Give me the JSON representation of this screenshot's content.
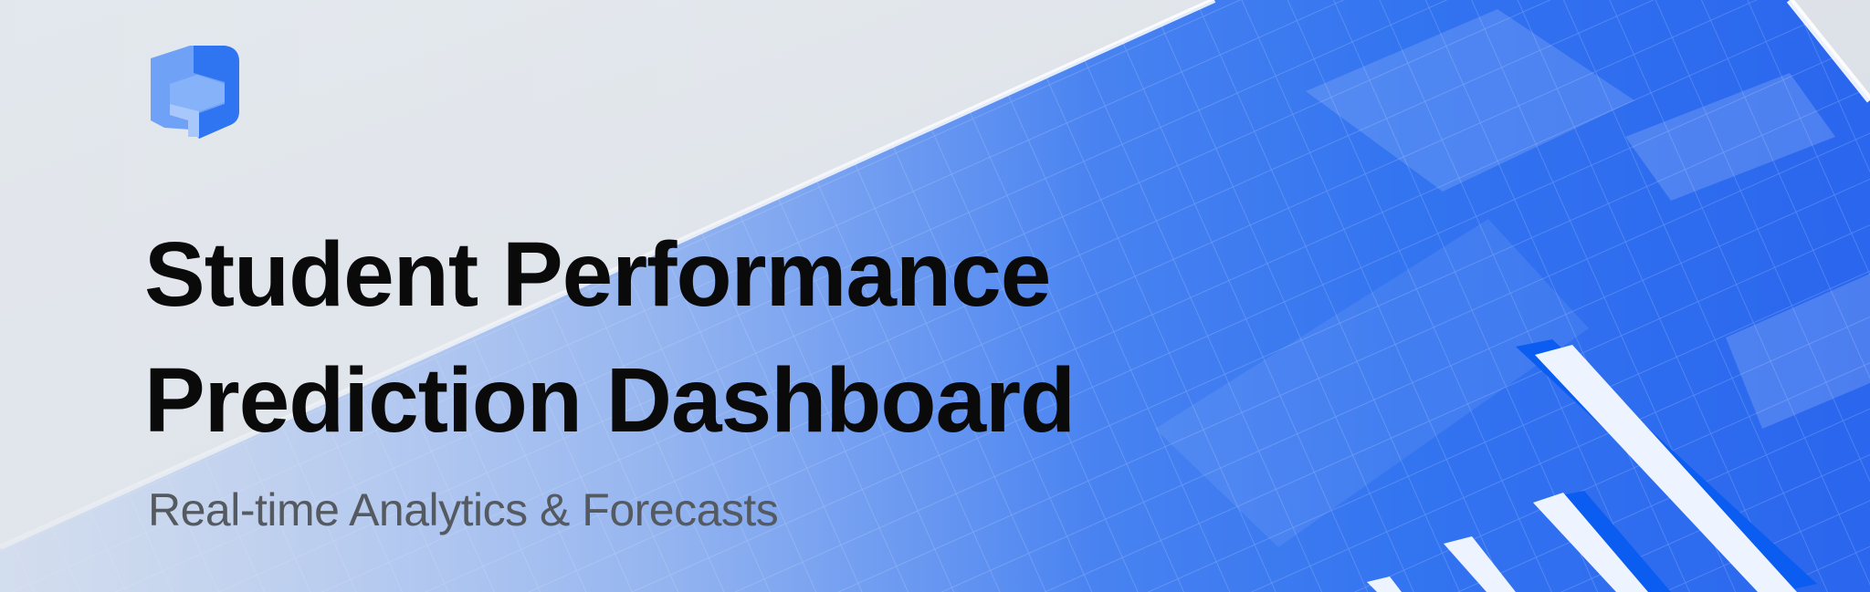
{
  "banner": {
    "logo_icon": "cube-icon",
    "title_line1": "Student Performance",
    "title_line2": "Prediction Dashboard",
    "subtitle": "Real-time Analytics & Forecasts"
  },
  "colors": {
    "accent": "#2f6ff0",
    "bar_highlight": "#eef4ff",
    "title": "#0a0a0a",
    "subtitle": "#555a61"
  }
}
